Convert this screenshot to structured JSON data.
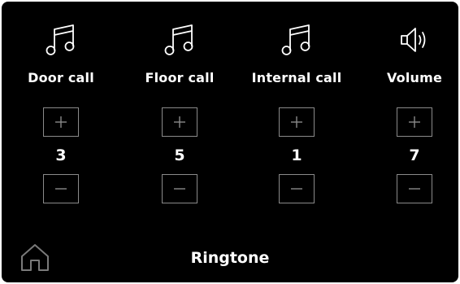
{
  "colors": {
    "background": "#000000",
    "text": "#ffffff",
    "button_border": "#8a8a8a",
    "icon": "#ffffff"
  },
  "controls": [
    {
      "id": "door-call",
      "icon": "music-note-icon",
      "label": "Door call",
      "value": "3"
    },
    {
      "id": "floor-call",
      "icon": "music-note-icon",
      "label": "Floor call",
      "value": "5"
    },
    {
      "id": "internal-call",
      "icon": "music-note-icon",
      "label": "Internal call",
      "value": "1"
    },
    {
      "id": "volume",
      "icon": "speaker-icon",
      "label": "Volume",
      "value": "7"
    }
  ],
  "buttons": {
    "increase_icon": "plus-icon",
    "decrease_icon": "minus-icon"
  },
  "footer": {
    "home_icon": "home-icon",
    "title": "Ringtone"
  }
}
